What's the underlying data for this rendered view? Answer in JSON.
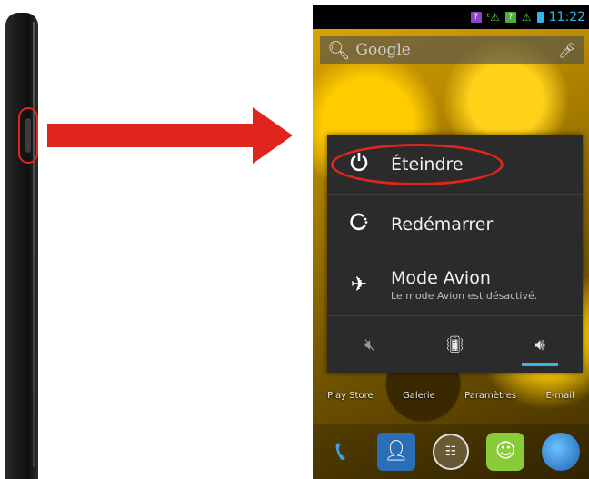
{
  "status_bar": {
    "sim1_label": "?",
    "sim2_label": "?",
    "sim1_color": "#8e44c8",
    "sim2_color": "#4caf3a",
    "time": "11:22"
  },
  "search": {
    "label": "Google"
  },
  "power_menu": {
    "options": [
      {
        "label": "Éteindre",
        "icon": "power-icon"
      },
      {
        "label": "Redémarrer",
        "icon": "reboot-icon"
      },
      {
        "label": "Mode Avion",
        "subtitle": "Le mode Avion est désactivé.",
        "icon": "airplane-icon"
      }
    ],
    "sound_modes": [
      {
        "icon": "mute-icon",
        "active": false
      },
      {
        "icon": "vibrate-icon",
        "active": false
      },
      {
        "icon": "sound-on-icon",
        "active": true
      }
    ]
  },
  "home": {
    "app_labels": [
      "Play Store",
      "Galerie",
      "Paramètres",
      "E-mail"
    ],
    "dock": [
      "phone-icon",
      "contacts-icon",
      "app-drawer-icon",
      "messaging-icon",
      "browser-icon"
    ]
  },
  "annotation": {
    "highlight_color": "#e0261c"
  }
}
